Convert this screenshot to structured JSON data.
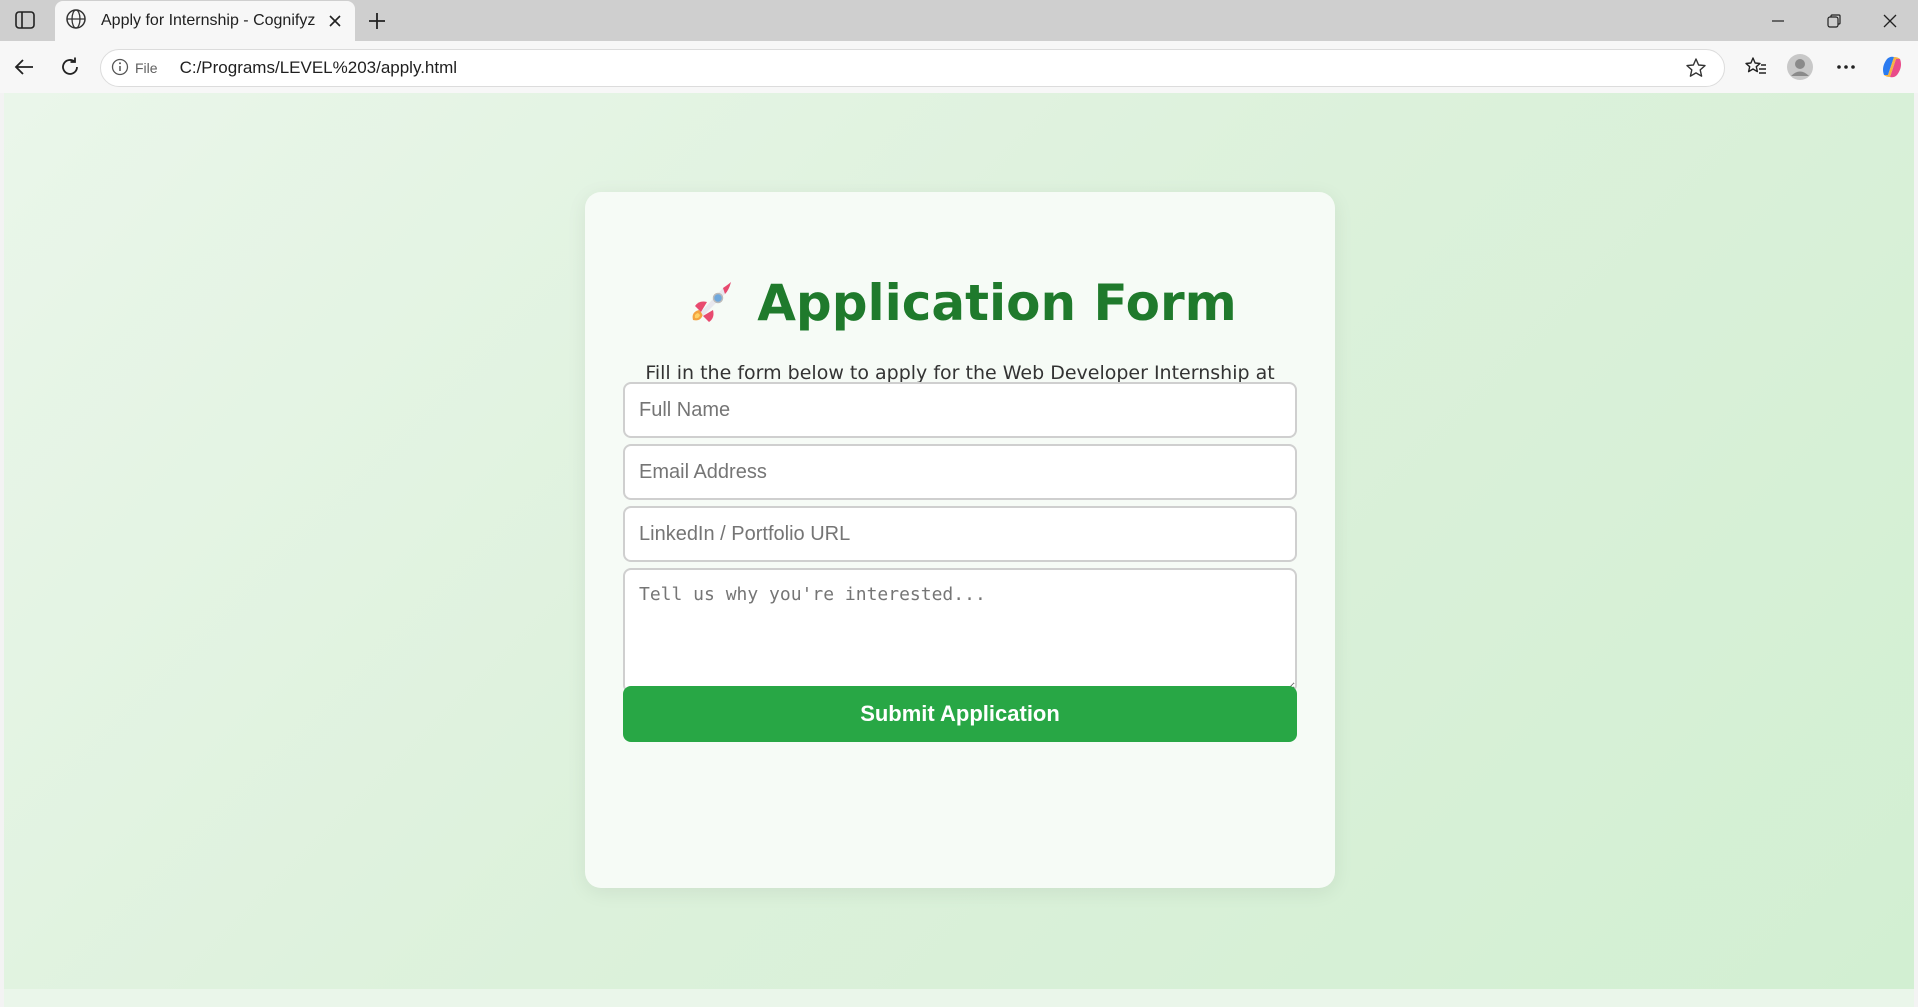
{
  "browser": {
    "tab_title": "Apply for Internship - Cognifyz",
    "site_info_label": "File",
    "url": "C:/Programs/LEVEL%203/apply.html"
  },
  "form": {
    "title": "Application Form",
    "title_emoji": "rocket-icon",
    "intro": "Fill in the form below to apply for the Web Developer Internship at Cognifyz Technologies.",
    "fields": {
      "name_placeholder": "Full Name",
      "email_placeholder": "Email Address",
      "url_placeholder": "LinkedIn / Portfolio URL",
      "message_placeholder": "Tell us why you're interested..."
    },
    "submit_label": "Submit Application"
  },
  "colors": {
    "title": "#1f7a2c",
    "submit": "#28a745",
    "page_bg": "#dcf1db"
  }
}
